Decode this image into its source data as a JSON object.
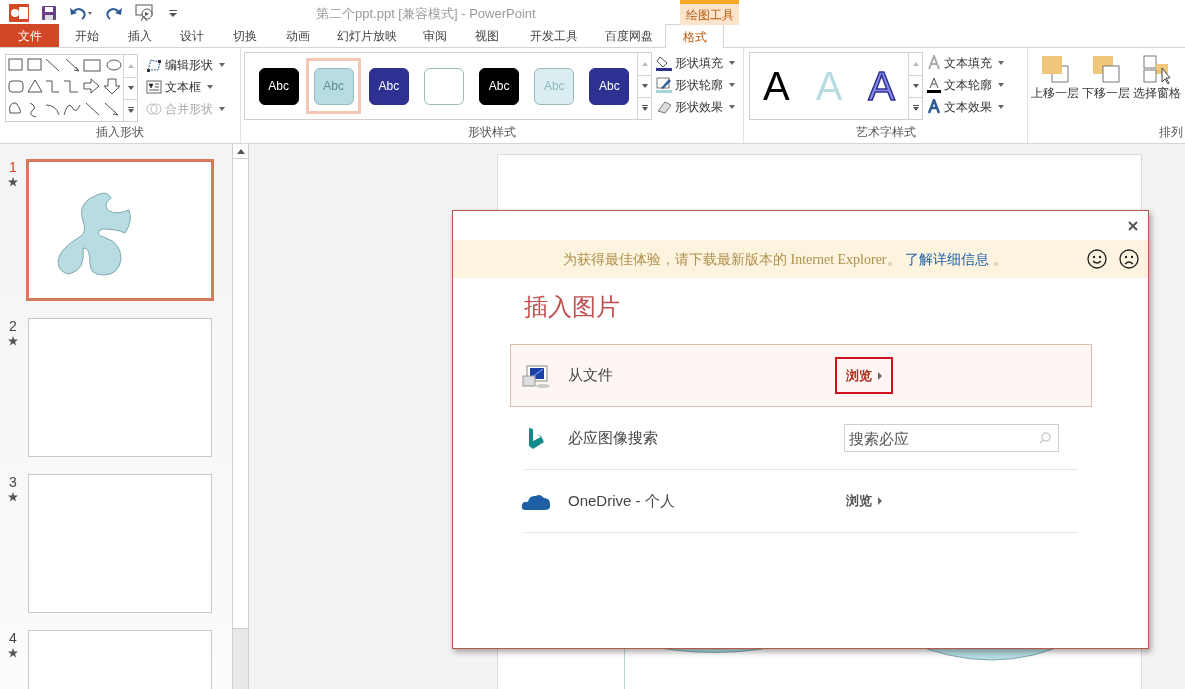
{
  "window": {
    "title": "第二个ppt.ppt [兼容模式] - PowerPoint",
    "context_tab": "绘图工具"
  },
  "tabs": [
    {
      "label": "文件",
      "kind": "file",
      "selected": false
    },
    {
      "label": "开始",
      "kind": "tab",
      "selected": false
    },
    {
      "label": "插入",
      "kind": "tab",
      "selected": false
    },
    {
      "label": "设计",
      "kind": "tab",
      "selected": false
    },
    {
      "label": "切换",
      "kind": "tab",
      "selected": false
    },
    {
      "label": "动画",
      "kind": "tab",
      "selected": false
    },
    {
      "label": "幻灯片放映",
      "kind": "tab",
      "selected": false
    },
    {
      "label": "审阅",
      "kind": "tab",
      "selected": false
    },
    {
      "label": "视图",
      "kind": "tab",
      "selected": false
    },
    {
      "label": "开发工具",
      "kind": "tab",
      "selected": false
    },
    {
      "label": "百度网盘",
      "kind": "tab",
      "selected": false
    },
    {
      "label": "格式",
      "kind": "context",
      "selected": true
    }
  ],
  "ribbon": {
    "insert_shapes": {
      "label": "插入形状",
      "buttons": [
        {
          "label": "编辑形状",
          "disabled": false
        },
        {
          "label": "文本框",
          "disabled": false
        },
        {
          "label": "合并形状",
          "disabled": true
        }
      ]
    },
    "shape_styles": {
      "label": "形状样式",
      "swatches": [
        {
          "label": "Abc",
          "color": "#000000",
          "selected": false
        },
        {
          "label": "Abc",
          "color": "#b7dde2",
          "selected": true
        },
        {
          "label": "Abc",
          "color": "#2e3192",
          "selected": false
        },
        {
          "color": "#ffffff",
          "selected": false
        },
        {
          "label": "Abc",
          "color": "#000000",
          "selected": false
        },
        {
          "label": "Abc",
          "color": "#daeef1",
          "selected": false
        },
        {
          "label": "Abc",
          "color": "#2e3192",
          "selected": false
        }
      ],
      "buttons": [
        "形状填充",
        "形状轮廓",
        "形状效果"
      ]
    },
    "wordart_styles": {
      "label": "艺术字样式",
      "letters": [
        {
          "text": "A",
          "kind": "black"
        },
        {
          "text": "A",
          "kind": "pale"
        },
        {
          "text": "A",
          "kind": "outlined"
        }
      ],
      "buttons": [
        "文本填充",
        "文本轮廓",
        "文本效果"
      ]
    },
    "arrange": {
      "label": "排列",
      "buttons": [
        "上移一层",
        "下移一层",
        "选择窗格"
      ]
    }
  },
  "slides": [
    {
      "number": "1",
      "selected": true,
      "kind": "shape"
    },
    {
      "number": "2",
      "selected": false,
      "kind": "blank"
    },
    {
      "number": "3",
      "selected": false,
      "kind": "blank"
    },
    {
      "number": "4",
      "selected": false,
      "kind": "blank"
    }
  ],
  "dialog": {
    "notice": "为获得最佳体验，请下载最新版本的 Internet Explorer。",
    "notice_link": "了解详细信息",
    "notice_end": "。",
    "title": "插入图片",
    "sources": [
      {
        "label": "从文件",
        "kind": "browse",
        "action": "浏览",
        "selected": true
      },
      {
        "label": "必应图像搜索",
        "kind": "search",
        "placeholder": "搜索必应",
        "selected": false
      },
      {
        "label": "OneDrive - 个人",
        "kind": "browse",
        "action": "浏览",
        "selected": false
      }
    ]
  }
}
